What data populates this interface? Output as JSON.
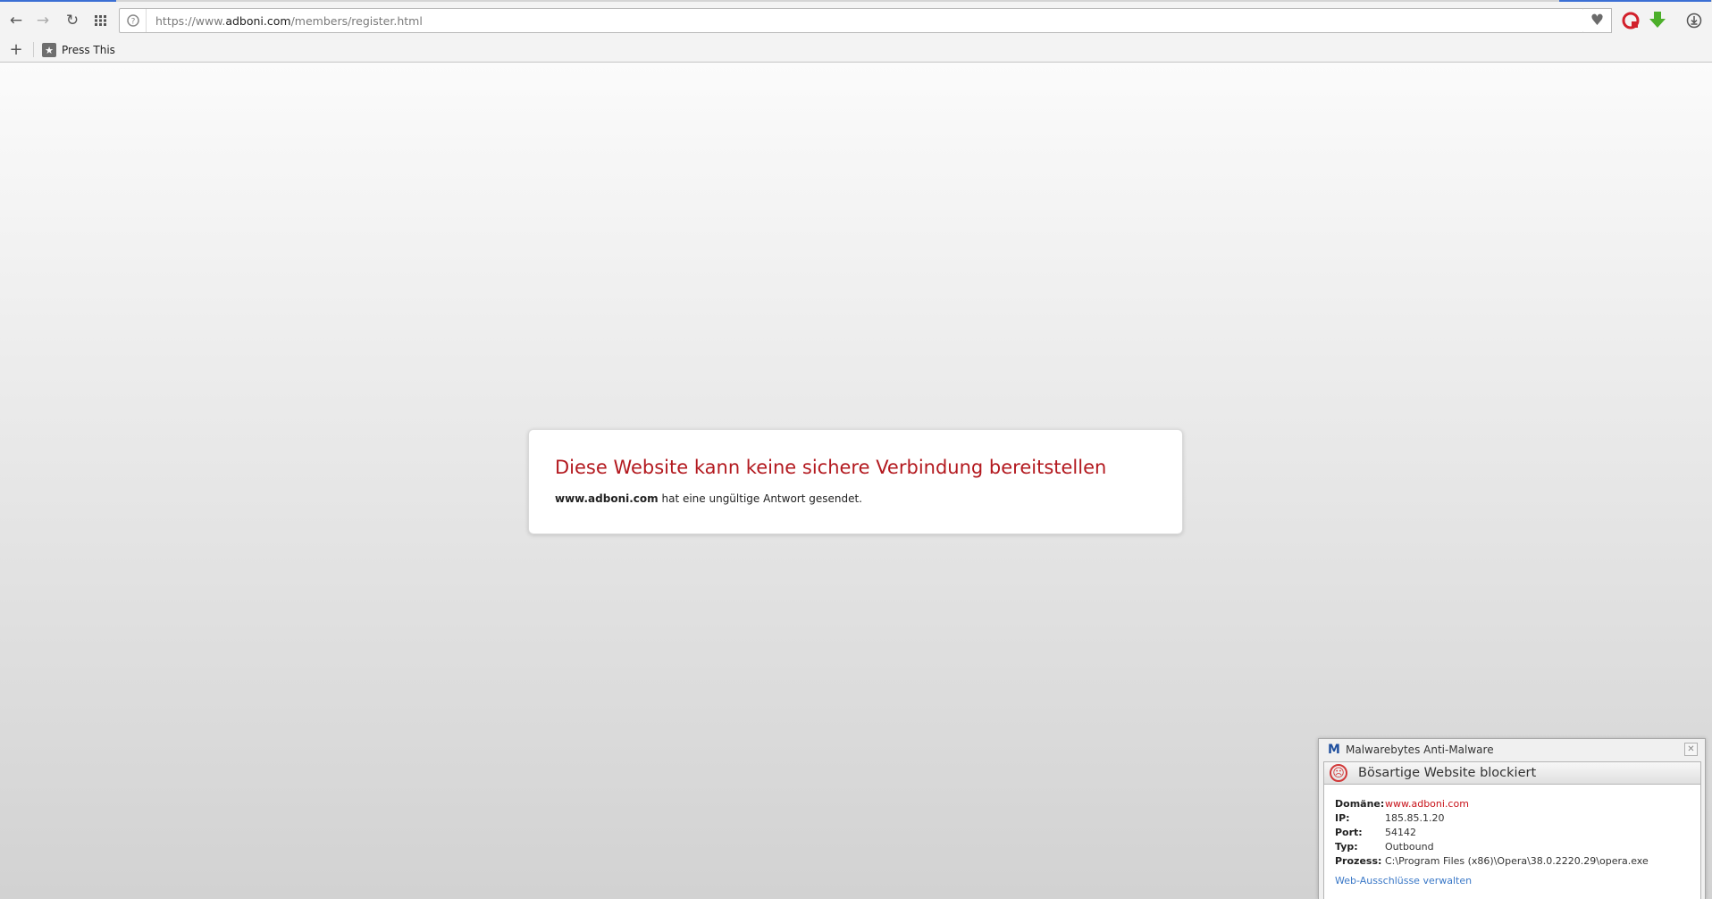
{
  "toolbar": {
    "url_scheme_prefix": "https://www.",
    "url_host": "adboni.com",
    "url_path": "/members/register.html"
  },
  "bookmarks": {
    "items": [
      {
        "label": "Press This"
      }
    ]
  },
  "error": {
    "title": "Diese Website kann keine sichere Verbindung bereitstellen",
    "domain": "www.adboni.com",
    "message": "hat eine ungültige Antwort gesendet."
  },
  "malwarebytes": {
    "app_name": "Malwarebytes Anti-Malware",
    "status": "Bösartige Website blockiert",
    "fields": [
      {
        "label": "Domäne:",
        "value": "www.adboni.com"
      },
      {
        "label": "IP:",
        "value": "185.85.1.20"
      },
      {
        "label": "Port:",
        "value": "54142"
      },
      {
        "label": "Typ:",
        "value": "Outbound"
      },
      {
        "label": "Prozess:",
        "value": "C:\\Program Files (x86)\\Opera\\38.0.2220.29\\opera.exe"
      }
    ],
    "manage_link": "Web-Ausschlüsse verwalten"
  },
  "colors": {
    "error_title": "#b3191f",
    "domain_highlight": "#c8141b",
    "link": "#3a78c7",
    "tab_accent": "#3b6fd4"
  }
}
